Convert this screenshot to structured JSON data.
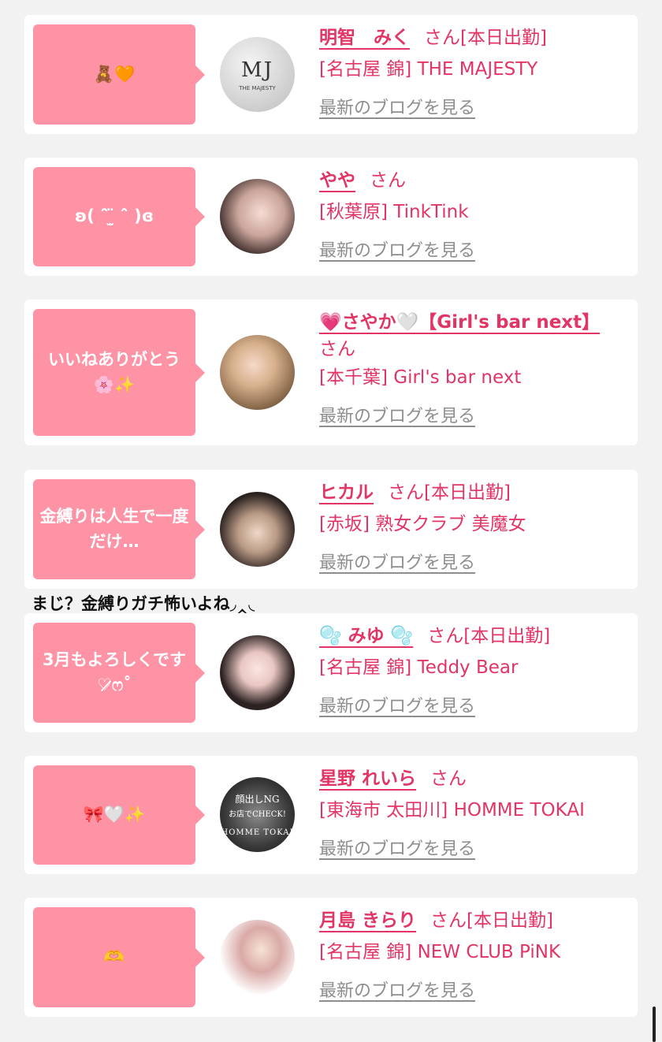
{
  "entries": [
    {
      "bubble": "🧸🧡",
      "name": "明智　みく",
      "san": "さん",
      "status": "[本日出勤]",
      "shop": "[名古屋 錦] THE MAJESTY",
      "blog": "最新のブログを見る"
    },
    {
      "bubble": "ʚ( ˆ̑ ̫̈ ˆ̑ )ɞ",
      "name": "やや",
      "san": "さん",
      "status": "",
      "shop": "[秋葉原] TinkTink",
      "blog": "最新のブログを見る"
    },
    {
      "bubble": "いいねありがとう🌸✨",
      "name": "💗さやか🤍【Girl's bar next】",
      "san": "さん",
      "status": "",
      "shop": "[本千葉] Girl's bar next",
      "blog": "最新のブログを見る"
    },
    {
      "bubble": "金縛りは人生で一度だけ…",
      "name": "ヒカル",
      "san": "さん",
      "status": "[本日出勤]",
      "shop": "[赤坂] 熟女クラブ 美魔女",
      "blog": "最新のブログを見る"
    },
    {
      "bubble": "3月もよろしくです♡̷̷̷ෆ˚",
      "name": "🫧 みゆ 🫧",
      "san": "さん",
      "status": "[本日出勤]",
      "shop": "[名古屋 錦] Teddy Bear",
      "blog": "最新のブログを見る"
    },
    {
      "bubble": "🎀🤍✨",
      "name": "星野 れいら",
      "san": "さん",
      "status": "",
      "shop": "[東海市 太田川] HOMME TOKAI",
      "blog": "最新のブログを見る"
    },
    {
      "bubble": "🫶",
      "name": "月島 きらり",
      "san": "さん",
      "status": "[本日出勤]",
      "shop": "[名古屋 錦] NEW CLUB PiNK",
      "blog": "最新のブログを見る"
    }
  ],
  "comment": "まじ？金縛りガチ怖いよね◞‸◟",
  "avatar_images": {
    "avatar_1": "logo-avatar-majesty",
    "avatar_2": "photo-avatar",
    "avatar_3": "photo-avatar",
    "avatar_4": "photo-avatar",
    "avatar_5": "photo-avatar",
    "avatar_6": "shop-banner-avatar",
    "avatar_7": "photo-avatar"
  },
  "avatar_logo_text": {
    "main": "MJ",
    "sub": "THE MAJESTY",
    "banner_top": "顔出しNG",
    "banner_mid": "お店でCHECK!",
    "banner_bottom": "HOMME TOKAI"
  },
  "colors": {
    "accent": "#e23565",
    "bubble": "#ff93a6",
    "link_gray": "#8e8e8e"
  }
}
